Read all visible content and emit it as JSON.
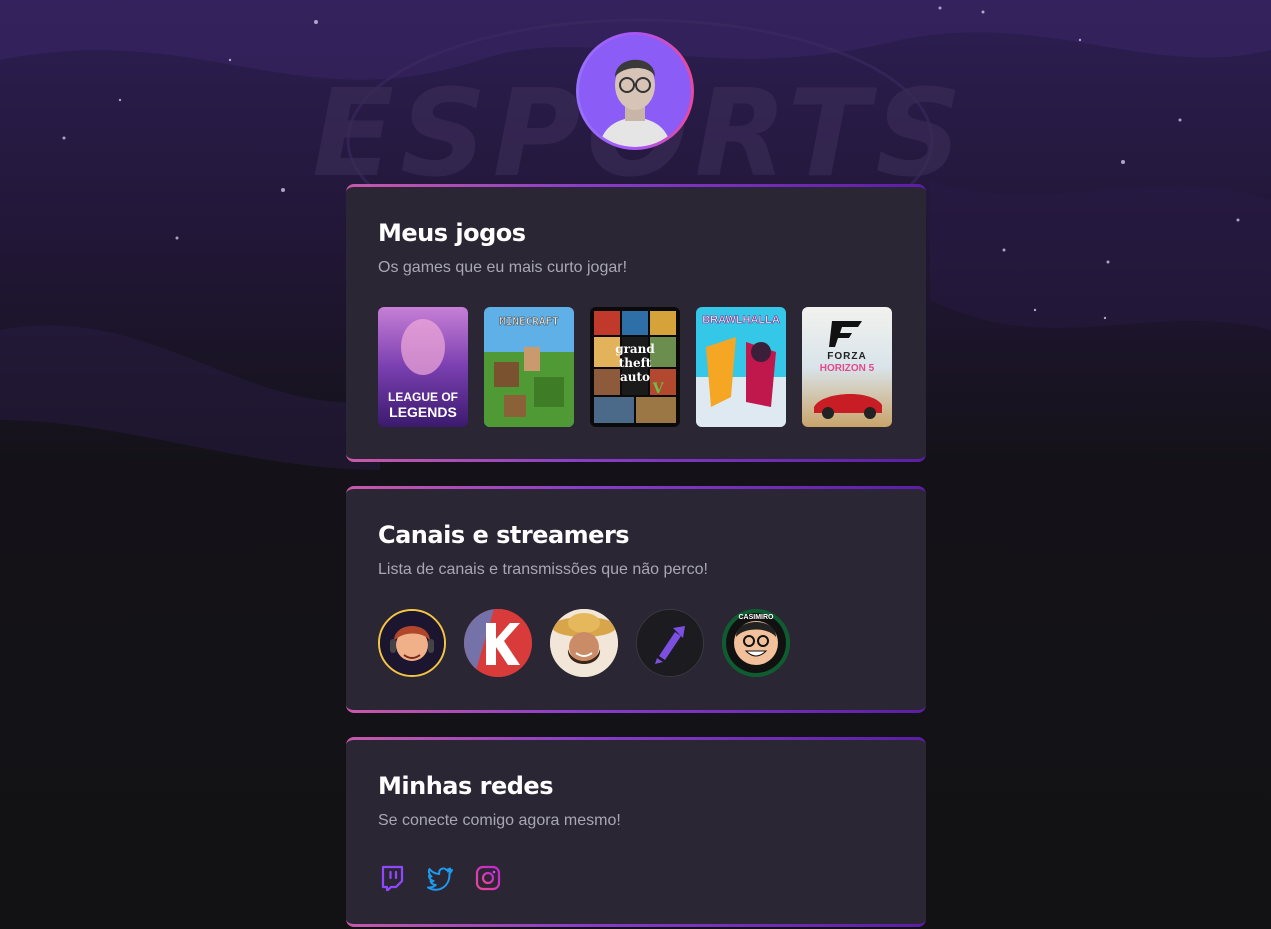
{
  "hero_text": "ESPORTS",
  "games_section": {
    "title": "Meus jogos",
    "subtitle": "Os games que eu mais curto jogar!",
    "games": [
      {
        "name": "League of Legends",
        "cover_text": [
          "LEAGUE OF",
          "LEGENDS"
        ]
      },
      {
        "name": "Minecraft",
        "cover_text": [
          "MINECRAFT"
        ]
      },
      {
        "name": "Grand Theft Auto V",
        "cover_text": [
          "grand",
          "theft",
          "auto",
          "V"
        ]
      },
      {
        "name": "Brawlhalla",
        "cover_text": [
          "BRAWLHALLA"
        ]
      },
      {
        "name": "Forza Horizon 5",
        "cover_text": [
          "FORZA",
          "HORIZON 5"
        ]
      }
    ]
  },
  "channels_section": {
    "title": "Canais e streamers",
    "subtitle": "Lista de canais e transmissões que não perco!",
    "channels": [
      {
        "name": "channel-1"
      },
      {
        "name": "channel-2"
      },
      {
        "name": "channel-3"
      },
      {
        "name": "channel-4"
      },
      {
        "name": "casimiro",
        "badge_text": "CASIMIRO"
      }
    ]
  },
  "socials_section": {
    "title": "Minhas redes",
    "subtitle": "Se conecte comigo agora mesmo!",
    "links": [
      {
        "icon": "twitch-icon",
        "color": "#9147ff"
      },
      {
        "icon": "twitter-icon",
        "color": "#1d9bf0"
      },
      {
        "icon": "instagram-icon",
        "color": "#e040fb"
      }
    ]
  },
  "colors": {
    "card_bg": "#2a2634",
    "page_bg": "#121214",
    "accent_purple": "#8a3ec8",
    "accent_pink": "#c85aa8"
  }
}
